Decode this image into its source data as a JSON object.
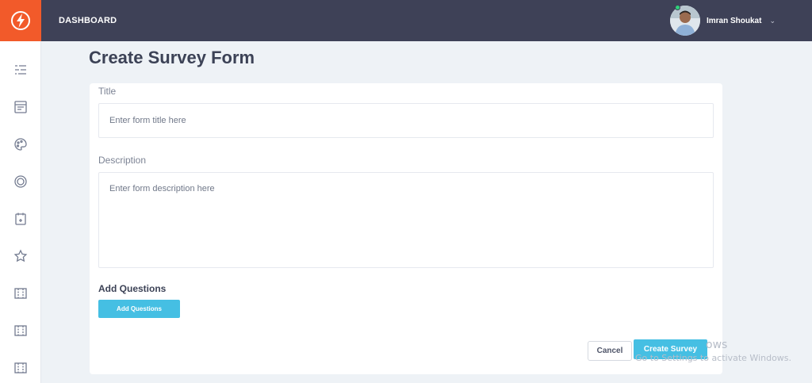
{
  "topbar": {
    "brand": "DASHBOARD",
    "user_name": "Imran Shoukat",
    "chevron": "⌄"
  },
  "sidebar": {
    "logo_icon": "lightning-bolt-logo",
    "items": [
      {
        "name": "list-icon"
      },
      {
        "name": "form-icon"
      },
      {
        "name": "palette-icon"
      },
      {
        "name": "target-icon"
      },
      {
        "name": "calendar-icon"
      },
      {
        "name": "star-icon"
      },
      {
        "name": "layout-icon"
      },
      {
        "name": "layout-icon"
      },
      {
        "name": "layout-icon"
      }
    ]
  },
  "page": {
    "title": "Create Survey Form"
  },
  "form": {
    "title_label": "Title",
    "title_placeholder": "Enter form title here",
    "description_label": "Description",
    "description_placeholder": "Enter form description here",
    "questions_heading": "Add Questions",
    "add_questions_button": "Add Questions",
    "cancel_button": "Cancel",
    "create_button": "Create Survey"
  },
  "watermark": {
    "line1": "ows",
    "line2": "Go to Settings to activate Windows."
  },
  "colors": {
    "accent_orange": "#f25a2a",
    "topbar_bg": "#3e4157",
    "primary_button": "#45bfe3",
    "online_status": "#2fd17a"
  }
}
